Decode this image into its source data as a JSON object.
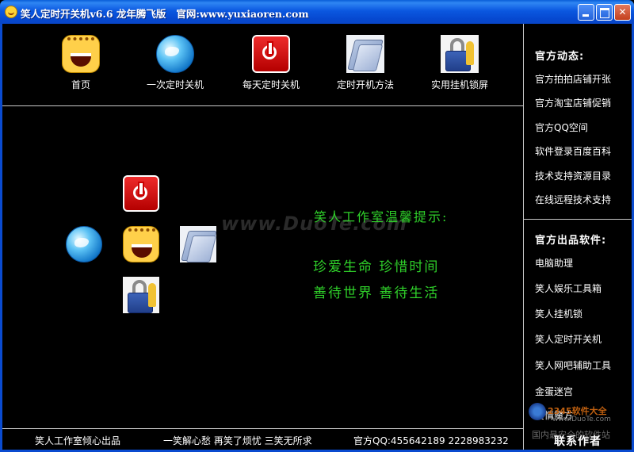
{
  "window": {
    "title": "笑人定时开关机v6.6 龙年腾飞版   官网:www.yuxiaoren.com",
    "controls": {
      "minimize": "",
      "maximize": "",
      "close": "✕"
    }
  },
  "toolbar": {
    "items": [
      {
        "label": "首页",
        "icon": "laughing-face-icon"
      },
      {
        "label": "一次定时关机",
        "icon": "globe-icon"
      },
      {
        "label": "每天定时关机",
        "icon": "power-icon"
      },
      {
        "label": "定时开机方法",
        "icon": "folder-icon"
      },
      {
        "label": "实用挂机锁屏",
        "icon": "lock-key-icon"
      }
    ]
  },
  "tips": {
    "title": "笑人工作室温馨提示:",
    "line1": "珍爱生命  珍惜时间",
    "line2": "善待世界  善待生活"
  },
  "watermark": "www.DuoTe.com",
  "sidebar": {
    "news_heading": "官方动态:",
    "news": [
      "官方拍拍店铺开张",
      "官方淘宝店铺促销",
      "官方QQ空间",
      "软件登录百度百科",
      "技术支持资源目录",
      "在线远程技术支持"
    ],
    "software_heading": "官方出品软件:",
    "software": [
      "电脑助理",
      "笑人娱乐工具箱",
      "笑人挂机锁",
      "笑人定时开关机",
      "笑人网吧辅助工具",
      "金蛋迷宫",
      "爱情魔方"
    ]
  },
  "site_watermark": {
    "line1": "2345软件大全",
    "line2": "www.DuoTe.com",
    "line3": "国内最安全的软件站"
  },
  "footer": {
    "credit": "笑人工作室倾心出品",
    "motto": "一笑解心愁 再笑了烦忧 三笑无所求",
    "qq": "官方QQ:455642189 2228983232",
    "contact": "联系作者"
  },
  "colors": {
    "background": "#000000",
    "tip_green": "#2fd12a",
    "titlebar_blue": "#0b58e0"
  }
}
